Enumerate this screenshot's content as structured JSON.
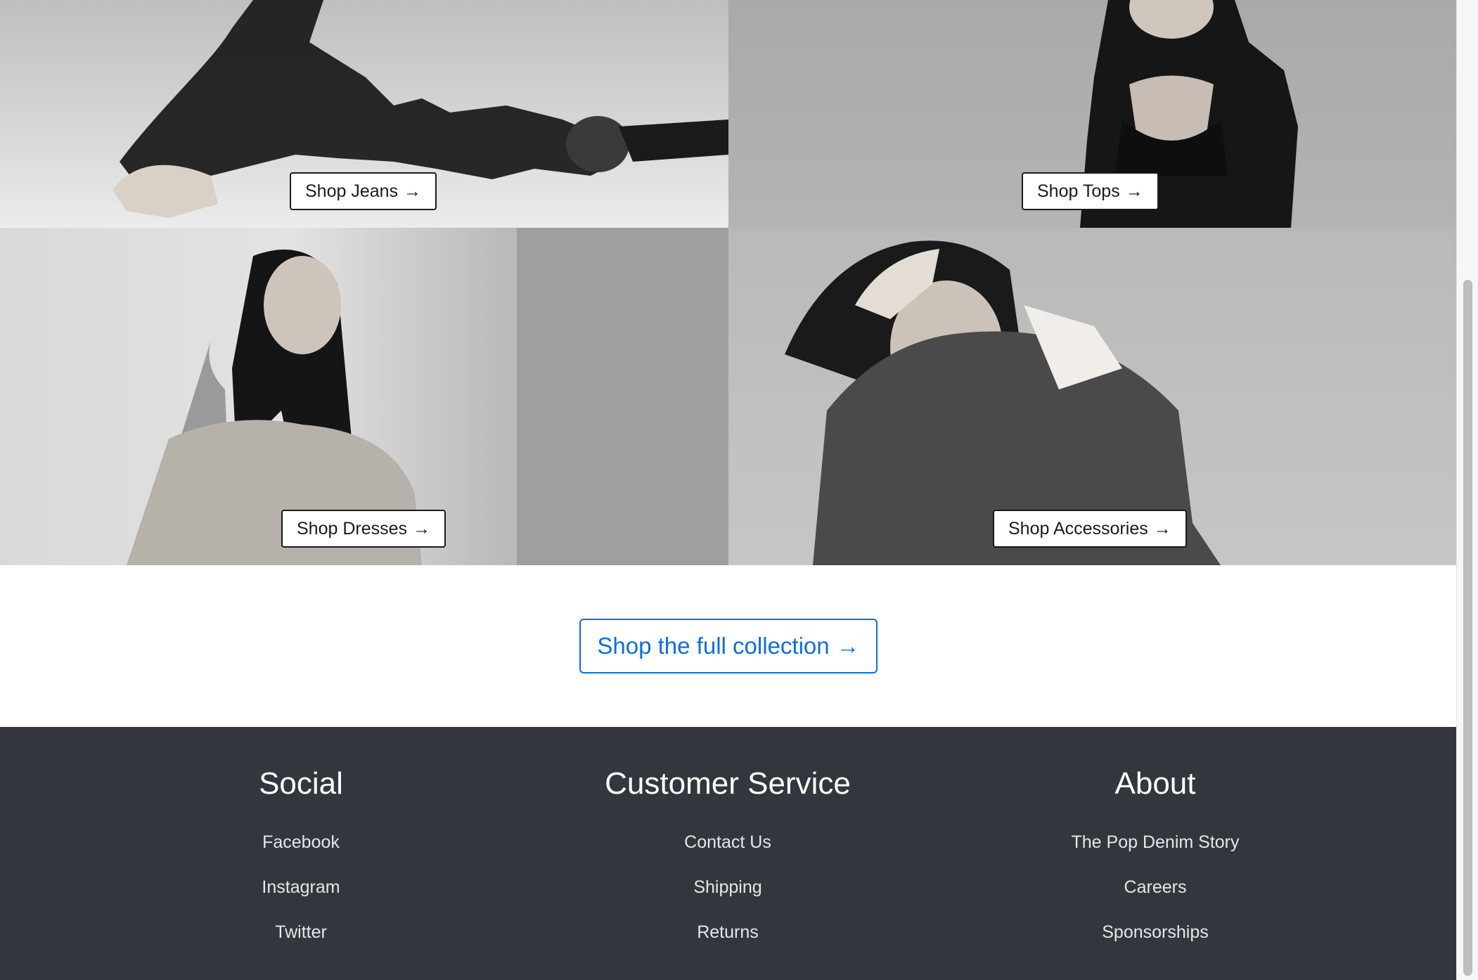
{
  "tiles": [
    {
      "name": "jeans",
      "button_label": "Shop Jeans",
      "arrow": "→"
    },
    {
      "name": "tops",
      "button_label": "Shop Tops",
      "arrow": "→"
    },
    {
      "name": "dresses",
      "button_label": "Shop Dresses",
      "arrow": "→"
    },
    {
      "name": "accessories",
      "button_label": "Shop Accessories",
      "arrow": "→"
    }
  ],
  "cta": {
    "label": "Shop the full collection",
    "arrow": "→",
    "color": "#0b6fe0"
  },
  "footer": {
    "background": "#33373d",
    "columns": [
      {
        "heading": "Social",
        "links": [
          "Facebook",
          "Instagram",
          "Twitter"
        ]
      },
      {
        "heading": "Customer Service",
        "links": [
          "Contact Us",
          "Shipping",
          "Returns"
        ]
      },
      {
        "heading": "About",
        "links": [
          "The Pop Denim Story",
          "Careers",
          "Sponsorships"
        ]
      }
    ]
  }
}
